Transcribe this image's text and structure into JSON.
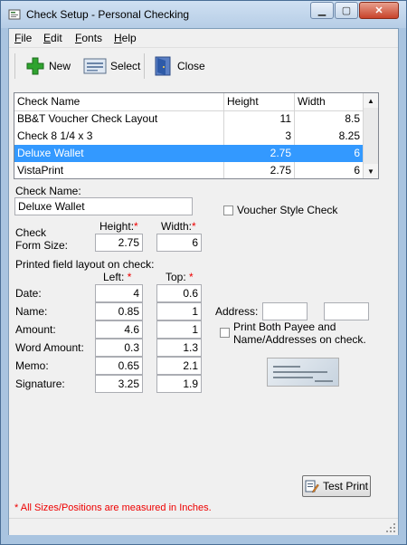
{
  "window": {
    "title": "Check Setup - Personal Checking"
  },
  "menu": [
    {
      "key": "F",
      "rest": "ile"
    },
    {
      "key": "E",
      "rest": "dit"
    },
    {
      "key": "F",
      "rest": "onts"
    },
    {
      "key": "H",
      "rest": "elp"
    }
  ],
  "toolbar": {
    "new_label": "New",
    "select_label": "Select",
    "close_label": "Close"
  },
  "checks_table": {
    "columns": [
      "Check Name",
      "Height",
      "Width"
    ],
    "rows": [
      {
        "name": "BB&T Voucher Check Layout",
        "height": "11",
        "width": "8.5"
      },
      {
        "name": "Check 8 1/4 x 3",
        "height": "3",
        "width": "8.25"
      },
      {
        "name": "Deluxe Wallet",
        "height": "2.75",
        "width": "6"
      },
      {
        "name": "VistaPrint",
        "height": "2.75",
        "width": "6"
      }
    ],
    "selected_index": 2
  },
  "form": {
    "check_name_label": "Check Name:",
    "check_name_value": "Deluxe Wallet",
    "voucher_label": "Voucher Style Check",
    "voucher_checked": false,
    "size_label_line1": "Check",
    "size_label_line2": "Form Size:",
    "height_header": "Height:",
    "width_header": "Width:",
    "height_value": "2.75",
    "width_value": "6",
    "layout_label": "Printed field layout on check:",
    "left_header": "Left:",
    "top_header": "Top:",
    "required_mark": "*",
    "fields": [
      {
        "label": "Date:",
        "left": "4",
        "top": "0.6"
      },
      {
        "label": "Name:",
        "left": "0.85",
        "top": "1"
      },
      {
        "label": "Amount:",
        "left": "4.6",
        "top": "1"
      },
      {
        "label": "Word Amount:",
        "left": "0.3",
        "top": "1.3"
      },
      {
        "label": "Memo:",
        "left": "0.65",
        "top": "2.1"
      },
      {
        "label": "Signature:",
        "left": "3.25",
        "top": "1.9"
      }
    ],
    "address_label": "Address:",
    "address_left": "",
    "address_top": "",
    "print_both_line1": "Print Both Payee and",
    "print_both_line2": "Name/Addresses on check.",
    "print_both_checked": false,
    "test_print_label": "Test Print",
    "note": "* All Sizes/Positions are measured in Inches."
  },
  "colors": {
    "selection": "#3399ff",
    "required": "#ee0000",
    "frame": "#a9c4e0"
  }
}
